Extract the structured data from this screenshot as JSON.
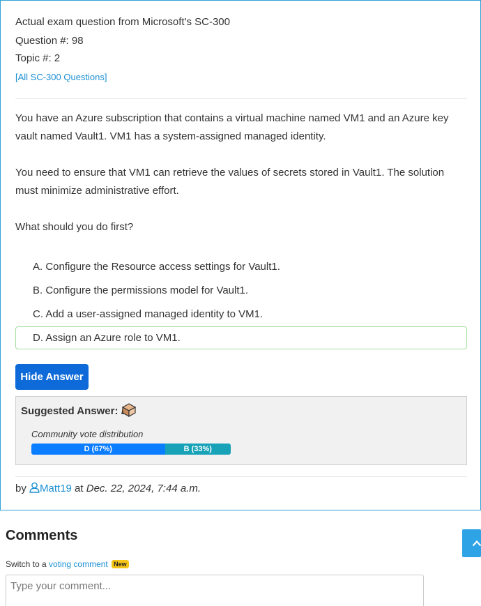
{
  "header": {
    "title": "Actual exam question from Microsoft's SC-300",
    "question_number": "Question #: 98",
    "topic": "Topic #: 2",
    "all_questions_link": "[All SC-300 Questions]"
  },
  "question": {
    "paragraph1": "You have an Azure subscription that contains a virtual machine named VM1 and an Azure key vault named Vault1. VM1 has a system-assigned managed identity.",
    "paragraph2": "You need to ensure that VM1 can retrieve the values of secrets stored in Vault1. The solution must minimize administrative effort.",
    "paragraph3": "What should you do first?"
  },
  "choices": [
    {
      "label": "A. Configure the Resource access settings for Vault1."
    },
    {
      "label": "B. Configure the permissions model for Vault1."
    },
    {
      "label": "C. Add a user-assigned managed identity to VM1."
    },
    {
      "label": "D. Assign an Azure role to VM1."
    }
  ],
  "hide_answer_label": "Hide Answer",
  "answer": {
    "suggested_label": "Suggested Answer:",
    "suggested_value": "D",
    "distribution_label": "Community vote distribution",
    "votes": [
      {
        "label": "D (67%)",
        "percent": 67,
        "color": "#0b7dff"
      },
      {
        "label": "B (33%)",
        "percent": 33,
        "color": "#17a2b8"
      }
    ]
  },
  "byline": {
    "by": "by",
    "user": "Matt19",
    "at": "at",
    "date": "Dec. 22, 2024, 7:44 a.m."
  },
  "comments": {
    "heading": "Comments",
    "switch_prefix": "Switch to a",
    "switch_link": "voting comment",
    "badge": "New",
    "input_placeholder": "Type your comment..."
  },
  "icons": {
    "user": "user-icon",
    "cube": "cube-icon",
    "scroll": "chevron-up-icon"
  },
  "colors": {
    "accent_border": "#2ea3d6",
    "link": "#1a8fd3",
    "button": "#0d6ad8",
    "correct_border": "#a3df9d"
  }
}
